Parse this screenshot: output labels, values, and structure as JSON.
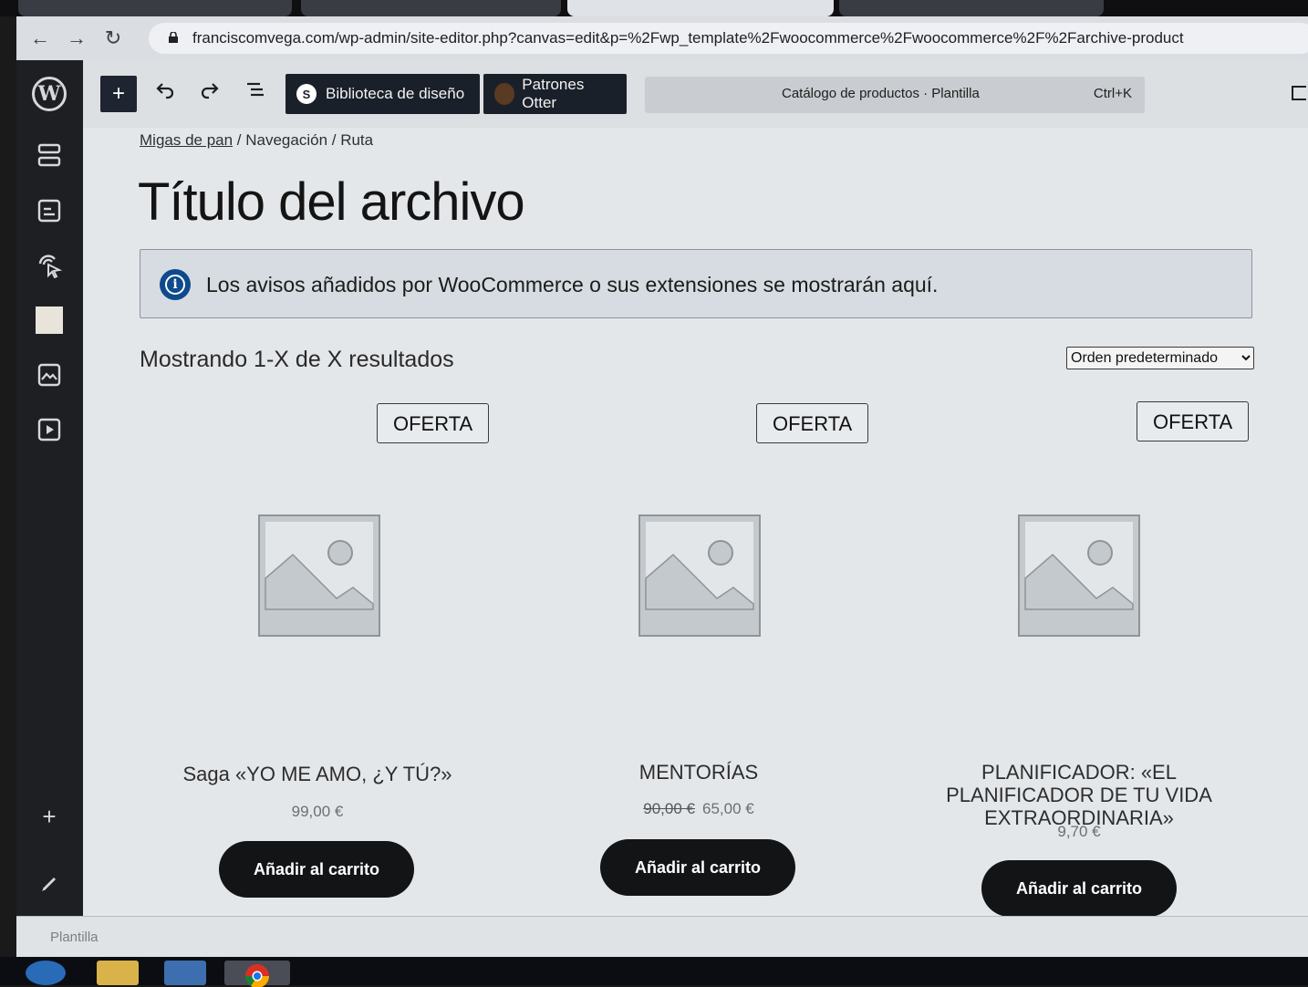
{
  "browser": {
    "url": "franciscomvega.com/wp-admin/site-editor.php?canvas=edit&p=%2Fwp_template%2Fwoocommerce%2Fwoocommerce%2F%2Farchive-product",
    "colors": {
      "tabstrip": "#0f0f12",
      "toolbar": "#dadde2"
    }
  },
  "editor": {
    "toolbar": {
      "inserter_icon": "plus-icon",
      "undo_icon": "undo-icon",
      "redo_icon": "redo-icon",
      "outline_icon": "document-overview-icon",
      "design_library_label": "Biblioteca de diseño",
      "otter_patterns_label": "Patrones Otter",
      "command_title": "Catálogo de productos · Plantilla",
      "command_shortcut": "Ctrl+K"
    },
    "leftrail": {
      "icons": [
        "wordpress-logo-icon",
        "navigation-icon",
        "styles-icon",
        "pages-icon",
        "templates-icon",
        "media-icon",
        "patterns-icon",
        "add-icon",
        "edit-icon"
      ],
      "footer_label": "Plantilla"
    }
  },
  "canvas": {
    "breadcrumb": {
      "link": "Migas de pan",
      "rest": " / Navegación / Ruta"
    },
    "page_title": "Título del archivo",
    "notice": "Los avisos añadidos por WooCommerce o sus extensiones se mostrarán aquí.",
    "result_count": "Mostrando 1-X de X resultados",
    "orderby_selected": "Orden predeterminado",
    "products": [
      {
        "badge": "OFERTA",
        "name": "Saga «YO ME AMO, ¿Y TÚ?»",
        "old_price": "",
        "price": "99,00 €",
        "button": "Añadir al carrito"
      },
      {
        "badge": "OFERTA",
        "name": "MENTORÍAS",
        "old_price": "90,00 €",
        "price": "65,00 €",
        "button": "Añadir al carrito"
      },
      {
        "badge": "OFERTA",
        "name": "PLANIFICADOR: «EL PLANIFICADOR DE TU VIDA EXTRAORDINARIA»",
        "old_price": "",
        "price": "9,70 €",
        "button": "Añadir al carrito"
      }
    ]
  }
}
